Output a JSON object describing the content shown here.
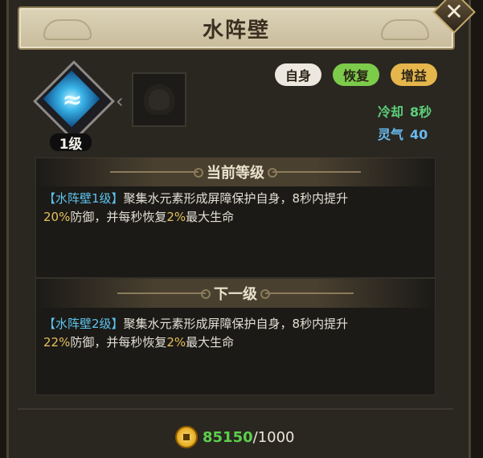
{
  "title": "水阵壁",
  "skill": {
    "level_label": "1级",
    "icon": "water-wave-icon",
    "next_icon": "locked-skill-icon"
  },
  "tags": [
    {
      "label": "自身",
      "color": "#ece8df"
    },
    {
      "label": "恢复",
      "color": "#7ccb4a"
    },
    {
      "label": "增益",
      "color": "#e5b64c"
    }
  ],
  "stats": {
    "cooldown_label": "冷却",
    "cooldown_value": "8秒",
    "spirit_label": "灵气",
    "spirit_value": "40"
  },
  "current": {
    "heading": "当前等级",
    "name": "【水阵壁1级】",
    "line1_text": "聚集水元素形成屏障保护自身，8秒内提升",
    "defense_pct": "20%",
    "line2_mid": "防御，并每秒恢复",
    "heal_pct": "2%",
    "line2_end": "最大生命"
  },
  "next": {
    "heading": "下一级",
    "name": "【水阵壁2级】",
    "line1_text": "聚集水元素形成屏障保护自身，8秒内提升",
    "defense_pct": "22%",
    "line2_mid": "防御，并每秒恢复",
    "heal_pct": "2%",
    "line2_end": "最大生命"
  },
  "cost": {
    "have": "85150",
    "need": "/1000",
    "icon": "coin-icon"
  },
  "colors": {
    "skill_name": "#5ec4ee",
    "highlight_value": "#e6c05a",
    "cooldown": "#5ccf7a",
    "spirit": "#68b9ee",
    "have_amount": "#5ccf4a"
  }
}
